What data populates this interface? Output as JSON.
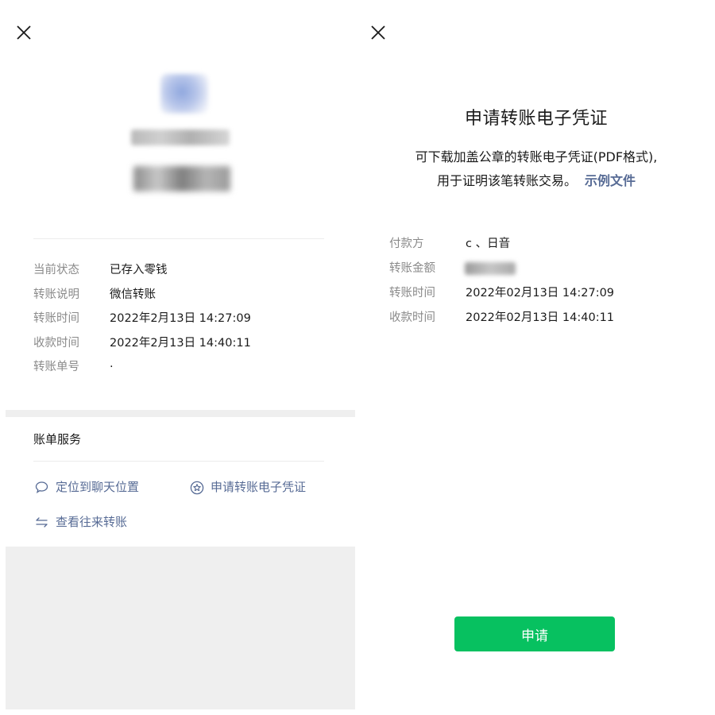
{
  "left_panel": {
    "details": [
      {
        "label": "当前状态",
        "value": "已存入零钱"
      },
      {
        "label": "转账说明",
        "value": "微信转账"
      },
      {
        "label": "转账时间",
        "value": "2022年2月13日 14:27:09"
      },
      {
        "label": "收款时间",
        "value": "2022年2月13日 14:40:11"
      },
      {
        "label": "转账单号",
        "value": "·"
      }
    ],
    "services": {
      "title": "账单服务",
      "locate_chat": "定位到聊天位置",
      "apply_voucher": "申请转账电子凭证",
      "view_history": "查看往来转账"
    }
  },
  "right_panel": {
    "title": "申请转账电子凭证",
    "description_line1": "可下载加盖公章的转账电子凭证(PDF格式),",
    "description_line2": "用于证明该笔转账交易。",
    "sample_link": "示例文件",
    "rows": [
      {
        "label": "付款方",
        "value": "c 、日音"
      },
      {
        "label": "转账金额",
        "value": ""
      },
      {
        "label": "转账时间",
        "value": "2022年02月13日 14:27:09"
      },
      {
        "label": "收款时间",
        "value": "2022年02月13日 14:40:11"
      }
    ],
    "apply_button": "申请"
  },
  "colors": {
    "link": "#576b95",
    "primary_button": "#07c160",
    "label_gray": "#8a8a8a",
    "section_gray": "#efefef"
  }
}
